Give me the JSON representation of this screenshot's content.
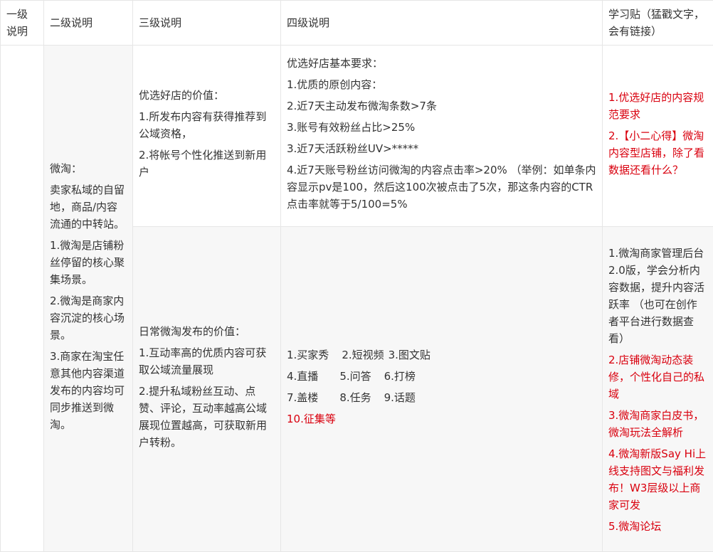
{
  "headers": [
    "一级说明",
    "二级说明",
    "三级说明",
    "四级说明",
    "学习贴（猛戳文字，会有链接）"
  ],
  "col2": {
    "title": "微淘：",
    "desc": "卖家私域的自留地，商品/内容流通的中转站。",
    "items": [
      "1.微淘是店铺粉丝停留的核心聚集场景。",
      "2.微淘是商家内容沉淀的核心场景。",
      "3.商家在淘宝任意其他内容渠道发布的内容均可同步推送到微淘。"
    ]
  },
  "row1": {
    "col3": {
      "title": "优选好店的价值：",
      "items": [
        "1.所发布内容有获得推荐到公域资格，",
        "2.将帐号个性化推送到新用户"
      ]
    },
    "col4": {
      "title": "优选好店基本要求：",
      "items": [
        "1.优质的原创内容：",
        "2.近7天主动发布微淘条数>7条",
        "3.账号有效粉丝占比>25%",
        "3.近7天活跃粉丝UV>*****",
        "4.近7天账号粉丝访问微淘的内容点击率>20% （举例：如单条内容显示pv是100，然后这100次被点击了5次，那这条内容的CTR点击率就等于5/100=5%"
      ]
    },
    "col5": {
      "links": [
        "1.优选好店的内容规范要求",
        "2.【小二心得】微淘内容型店铺，除了看数据还看什么？"
      ]
    }
  },
  "row2": {
    "col3": {
      "title": "日常微淘发布的价值：",
      "items": [
        "1.互动率高的优质内容可获取公域流量展现",
        "2.提升私域粉丝互动、点赞、评论，互动率越高公域展现位置越高，可获取新用户转粉。"
      ]
    },
    "col4": {
      "grid": [
        [
          "1.买家秀",
          "2.短视频",
          "3.图文贴"
        ],
        [
          "4.直播",
          "5.问答",
          "6.打榜"
        ],
        [
          "7.盖楼",
          "8.任务",
          "9.话题"
        ]
      ],
      "last": "10.征集等"
    },
    "col5": {
      "first": "1.微淘商家管理后台2.0版，学会分析内容数据，提升内容活跃率 （也可在创作者平台进行数据查看）",
      "links": [
        "2.店铺微淘动态装修，个性化自己的私域",
        "3.微淘商家白皮书，微淘玩法全解析",
        "4.微淘新版Say Hi上线支持图文与福利发布！W3层级以上商家可发",
        "5.微淘论坛"
      ]
    }
  },
  "colors": {
    "link_red": "#d9000e",
    "text": "#333333",
    "border": "#e6e6e6",
    "shade": "#f7f7f7"
  }
}
